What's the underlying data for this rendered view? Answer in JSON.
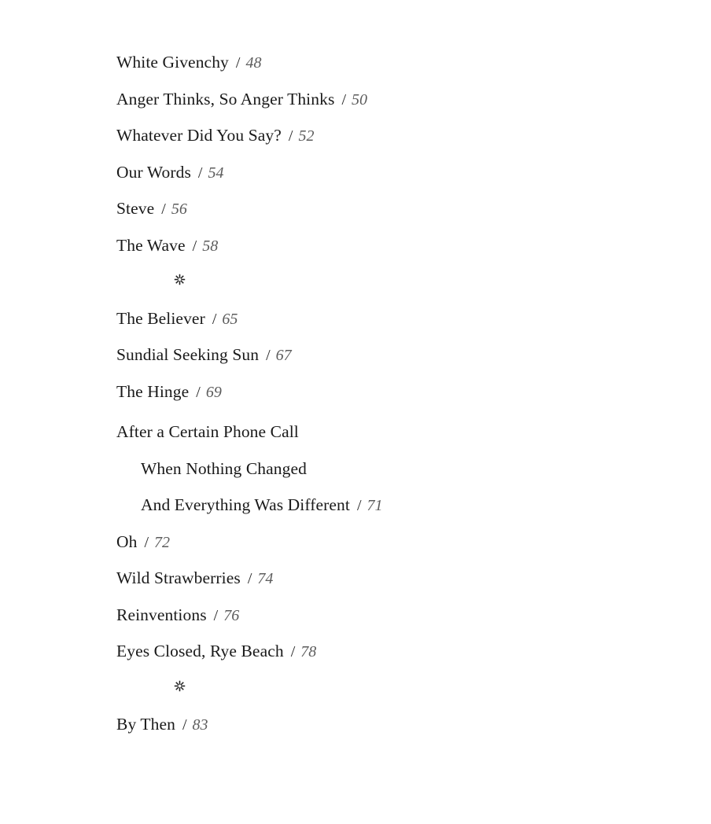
{
  "document": {
    "type": "table-of-contents",
    "separator_symbol": "/",
    "ornament_symbol": "✳",
    "colors": {
      "background": "#ffffff",
      "title_text": "#1a1a1a",
      "page_number_text": "#5c5c5c",
      "separator_text": "#272727"
    }
  },
  "entries": [
    {
      "kind": "single",
      "title": "White Givenchy",
      "sep": "/",
      "page": "48"
    },
    {
      "kind": "single",
      "title": "Anger Thinks, So Anger Thinks",
      "sep": "/",
      "page": "50"
    },
    {
      "kind": "single",
      "title": "Whatever Did You Say?",
      "sep": "/",
      "page": "52"
    },
    {
      "kind": "single",
      "title": "Our Words",
      "sep": "/",
      "page": "54"
    },
    {
      "kind": "single",
      "title": "Steve",
      "sep": "/",
      "page": "56"
    },
    {
      "kind": "single",
      "title": "The Wave",
      "sep": "/",
      "page": "58"
    },
    {
      "kind": "ornament",
      "symbol": "✳"
    },
    {
      "kind": "single",
      "title": "The Believer",
      "sep": "/",
      "page": "65"
    },
    {
      "kind": "single",
      "title": "Sundial Seeking Sun",
      "sep": "/",
      "page": "67"
    },
    {
      "kind": "single",
      "title": "The Hinge",
      "sep": "/",
      "page": "69"
    },
    {
      "kind": "group",
      "lines": [
        {
          "text": "After a Certain Phone Call",
          "indented": false
        },
        {
          "text": "When Nothing Changed",
          "indented": true
        },
        {
          "text": "And Everything Was Different",
          "indented": true
        }
      ],
      "sep": "/",
      "page": "71"
    },
    {
      "kind": "single",
      "title": "Oh",
      "sep": "/",
      "page": "72"
    },
    {
      "kind": "single",
      "title": "Wild Strawberries",
      "sep": "/",
      "page": "74"
    },
    {
      "kind": "single",
      "title": "Reinventions",
      "sep": "/",
      "page": "76"
    },
    {
      "kind": "single",
      "title": "Eyes Closed, Rye Beach",
      "sep": "/",
      "page": "78"
    },
    {
      "kind": "ornament",
      "symbol": "✳"
    },
    {
      "kind": "single",
      "title": "By Then",
      "sep": "/",
      "page": "83"
    }
  ]
}
